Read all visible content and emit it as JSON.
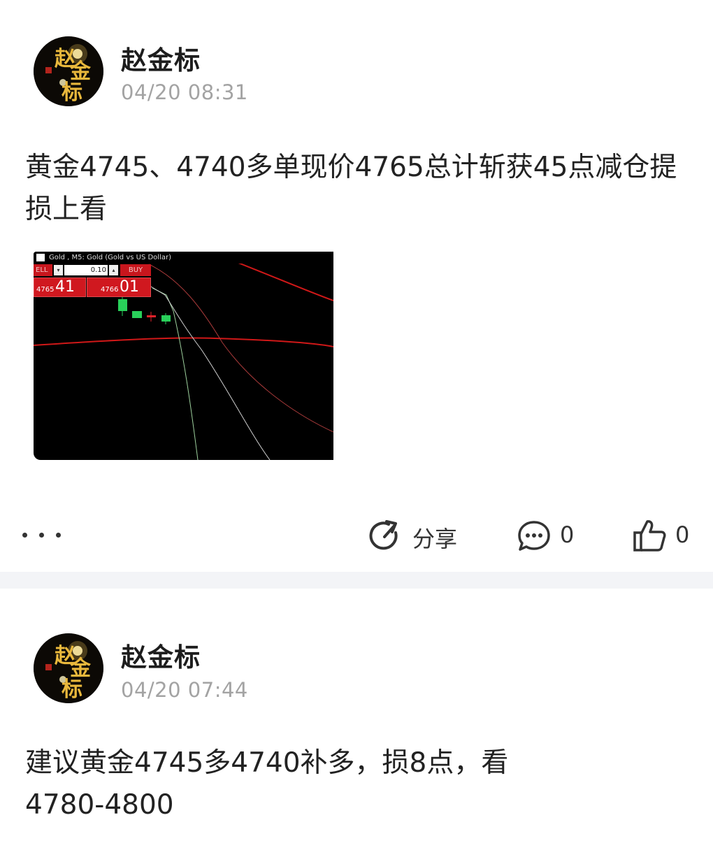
{
  "posts": [
    {
      "author": "赵金标",
      "time": "04/20 08:31",
      "content": "黄金4745、4740多单现价4765总计斩获45点减仓提损上看",
      "screenshot": {
        "window_title": "Gold , M5: Gold (Gold vs US Dollar)",
        "sell_label": "ELL",
        "buy_label": "BUY",
        "lot_value": "0.10",
        "sell_price_small": "4765",
        "sell_price_big": "41",
        "buy_price_small": "4766",
        "buy_price_big": "01"
      },
      "actions": {
        "share_label": "分享",
        "comment_count": "0",
        "like_count": "0"
      }
    },
    {
      "author": "赵金标",
      "time": "04/20 07:44",
      "content": "建议黄金4745多4740补多，损8点，看\n4780-4800"
    }
  ],
  "colors": {
    "accent_red": "#d0181f",
    "time_gray": "#a3a3a3",
    "divider": "#f3f4f7"
  },
  "icons": [
    "avatar-logo",
    "more-icon",
    "share-icon",
    "comment-icon",
    "like-icon"
  ]
}
